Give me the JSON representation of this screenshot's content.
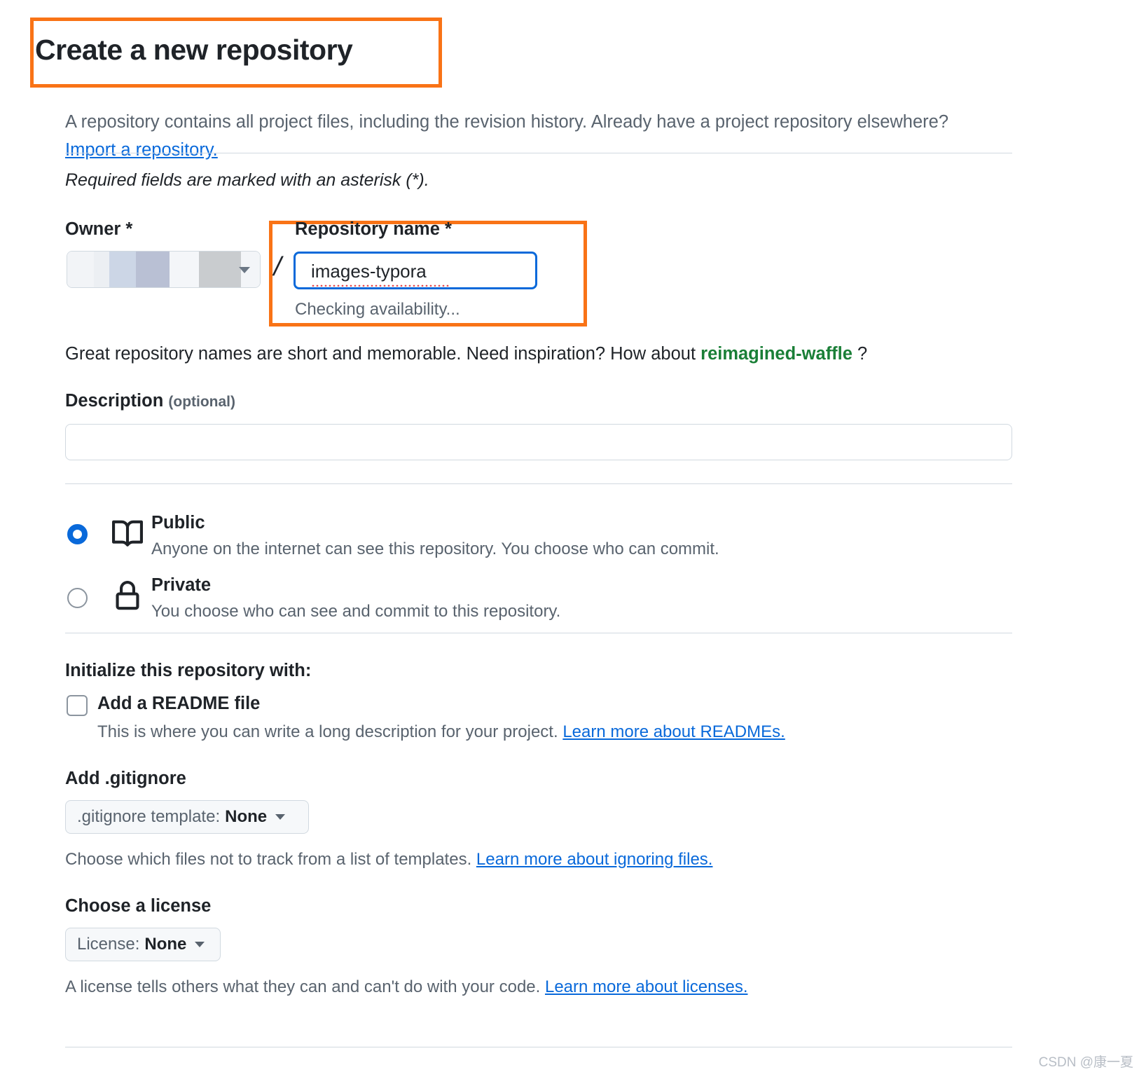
{
  "header": {
    "title": "Create a new repository",
    "intro_part1": "A repository contains all project files, including the revision history. Already have a project repository elsewhere? ",
    "intro_link": "Import a repository.",
    "required_note": "Required fields are marked with an asterisk (*)."
  },
  "owner": {
    "label": "Owner *",
    "separator": "/"
  },
  "repository_name": {
    "label": "Repository name *",
    "value": "images-typora",
    "status": "Checking availability...",
    "focus_color": "#0969da"
  },
  "inspiration": {
    "prefix": "Great repository names are short and memorable. Need inspiration? How about ",
    "suggestion": "reimagined-waffle",
    "suffix": " ?",
    "suggestion_color": "#1a7f37"
  },
  "description": {
    "label": "Description ",
    "optional": "(optional)",
    "value": "",
    "placeholder": ""
  },
  "visibility": {
    "options": [
      {
        "id": "public",
        "title": "Public",
        "description": "Anyone on the internet can see this repository. You choose who can commit.",
        "icon": "book-icon",
        "selected": true
      },
      {
        "id": "private",
        "title": "Private",
        "description": "You choose who can see and commit to this repository.",
        "icon": "lock-icon",
        "selected": false
      }
    ]
  },
  "initialize": {
    "heading": "Initialize this repository with:",
    "readme": {
      "label": "Add a README file",
      "checked": false,
      "help_prefix": "This is where you can write a long description for your project. ",
      "help_link": "Learn more about READMEs."
    }
  },
  "gitignore": {
    "heading": "Add .gitignore",
    "dropdown_prefix": ".gitignore template:",
    "dropdown_value": "None",
    "help_prefix": "Choose which files not to track from a list of templates. ",
    "help_link": "Learn more about ignoring files."
  },
  "license": {
    "heading": "Choose a license",
    "dropdown_prefix": "License:",
    "dropdown_value": "None",
    "help_prefix": "A license tells others what they can and can't do with your code. ",
    "help_link": "Learn more about licenses."
  },
  "annotations": {
    "highlight_color": "#f97316",
    "boxes": [
      "title-highlight",
      "repository-name-highlight"
    ]
  },
  "watermark": {
    "text": "CSDN @康一夏"
  }
}
